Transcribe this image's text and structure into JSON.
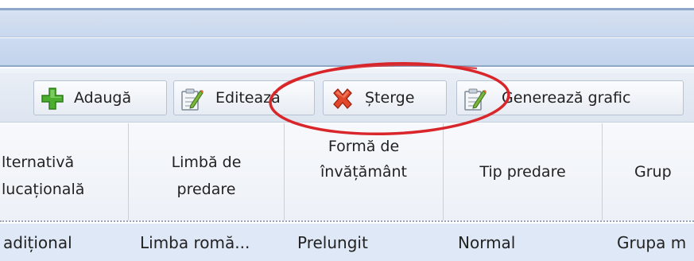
{
  "toolbar": {
    "add_label": "Adaugă",
    "edit_label": "Editează",
    "delete_label": "Șterge",
    "chart_label": "Generează grafic"
  },
  "table": {
    "columns": [
      {
        "lines": [
          "lternativă",
          "lucațională"
        ]
      },
      {
        "lines": [
          "Limbă de",
          "predare"
        ]
      },
      {
        "lines": [
          "Formă de",
          "învățământ"
        ]
      },
      {
        "lines": [
          "Tip predare"
        ]
      },
      {
        "lines": [
          "Grup"
        ]
      }
    ],
    "rows": [
      [
        "adițional",
        "Limba romă...",
        "Prelungit",
        "Normal",
        "Grupa m"
      ]
    ]
  },
  "colors": {
    "annotation_ellipse": "#d8262b",
    "selected_row": "#dfe8f6",
    "add_icon": "#4cae2f",
    "delete_icon": "#e2462b"
  },
  "icons": [
    "plus-icon",
    "edit-icon",
    "delete-x-icon",
    "chart-edit-icon"
  ]
}
